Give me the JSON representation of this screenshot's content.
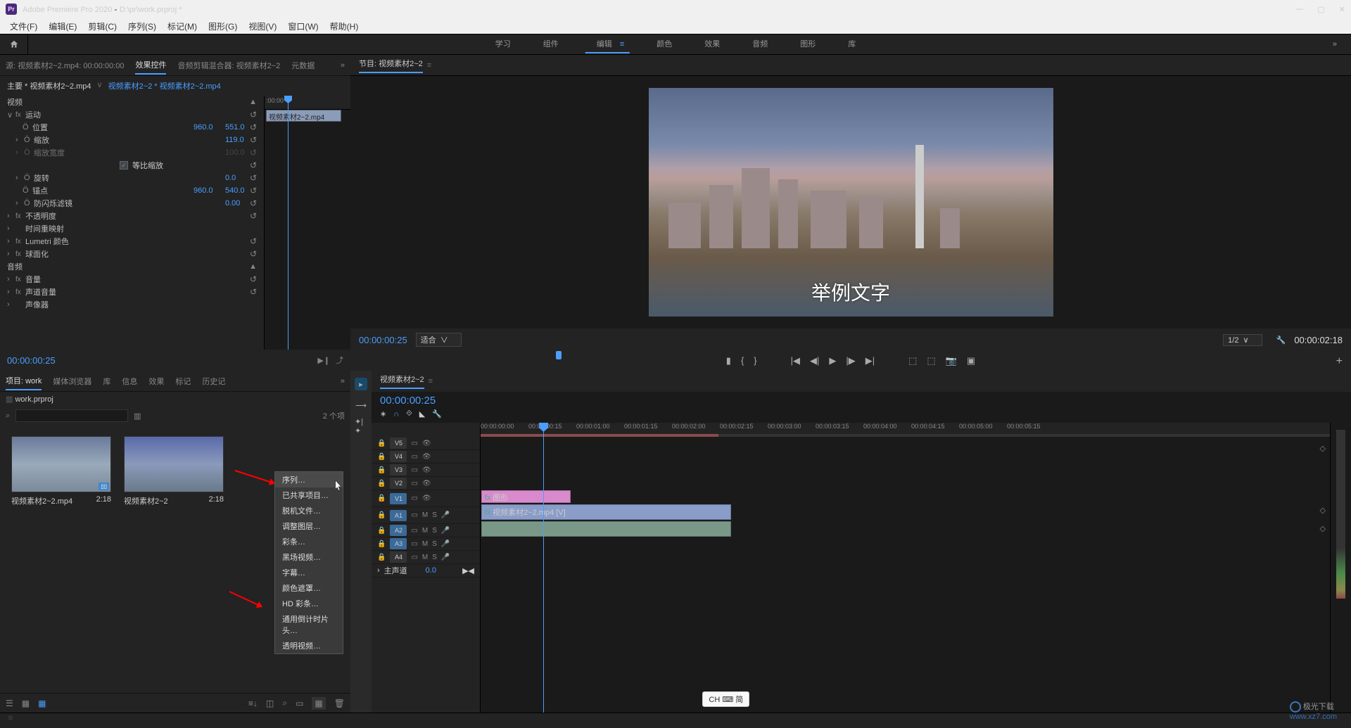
{
  "titlebar": {
    "app": "Adobe Premiere Pro 2020",
    "file": "D:\\pr\\work.prproj *"
  },
  "menu": [
    "文件(F)",
    "编辑(E)",
    "剪辑(C)",
    "序列(S)",
    "标记(M)",
    "图形(G)",
    "视图(V)",
    "窗口(W)",
    "帮助(H)"
  ],
  "workspace": {
    "tabs": [
      "学习",
      "组件",
      "编辑",
      "颜色",
      "效果",
      "音频",
      "图形",
      "库"
    ],
    "active": 2
  },
  "effectControls": {
    "tabs": [
      "源: 视频素材2~2.mp4: 00:00:00:00",
      "效果控件",
      "音频剪辑混合器: 视频素材2~2",
      "元数据"
    ],
    "activeTab": 1,
    "master": "主要 * 视频素材2~2.mp4",
    "clip": "视频素材2~2 * 视频素材2~2.mp4",
    "clipLabel": "视频素材2~2.mp4",
    "videoSection": "视频",
    "motion": "运动",
    "position": {
      "label": "位置",
      "x": "960.0",
      "y": "551.0"
    },
    "scale": {
      "label": "缩放",
      "value": "119.0"
    },
    "scaleWidth": {
      "label": "缩放宽度",
      "value": "100.0"
    },
    "uniform": {
      "label": "等比缩放"
    },
    "rotation": {
      "label": "旋转",
      "value": "0.0"
    },
    "anchor": {
      "label": "锚点",
      "x": "960.0",
      "y": "540.0"
    },
    "flicker": {
      "label": "防闪烁滤镜",
      "value": "0.00"
    },
    "opacity": "不透明度",
    "timeremap": "时间重映射",
    "lumetri": "Lumetri 颜色",
    "spherize": "球面化",
    "audioSection": "音频",
    "volume": "音量",
    "channelVolume": "声道音量",
    "panner": "声像器",
    "timecode": "00:00:00:25",
    "rulerStart": ":00:00"
  },
  "program": {
    "title": "节目: 视频素材2~2",
    "overlayText": "举例文字",
    "timecode": "00:00:00:25",
    "fit": "适合",
    "zoom": "1/2",
    "duration": "00:00:02:18"
  },
  "project": {
    "tabs": [
      "项目: work",
      "媒体浏览器",
      "库",
      "信息",
      "效果",
      "标记",
      "历史记"
    ],
    "activeTab": 0,
    "path": "work.prproj",
    "count": "2 个项",
    "bins": [
      {
        "name": "视频素材2~2.mp4",
        "dur": "2:18",
        "hasBadge": true
      },
      {
        "name": "视频素材2~2",
        "dur": "2:18",
        "hasBadge": false
      }
    ]
  },
  "contextMenu": [
    "序列…",
    "已共享项目…",
    "脱机文件…",
    "调整图层…",
    "彩条…",
    "黑场视频…",
    "字幕…",
    "颜色遮罩…",
    "HD 彩条…",
    "通用倒计时片头…",
    "透明视频…"
  ],
  "timeline": {
    "title": "视频素材2~2",
    "timecode": "00:00:00:25",
    "ticks": [
      "00:00:00:00",
      "00:00:00:15",
      "00:00:01:00",
      "00:00:01:15",
      "00:00:02:00",
      "00:00:02:15",
      "00:00:03:00",
      "00:00:03:15",
      "00:00:04:00",
      "00:00:04:15",
      "00:00:05:00",
      "00:00:05:15"
    ],
    "tracks": {
      "video": [
        "V5",
        "V4",
        "V3",
        "V2",
        "V1"
      ],
      "audio": [
        "A1",
        "A2",
        "A3",
        "A4"
      ],
      "master": "主声道",
      "masterVal": "0.0"
    },
    "clips": {
      "v2": "图形",
      "v1": "视频素材2~2.mp4 [V]"
    }
  },
  "ime": "CH ⌨ 简",
  "watermark": {
    "brand": "极光下载",
    "url": "www.xz7.com"
  }
}
